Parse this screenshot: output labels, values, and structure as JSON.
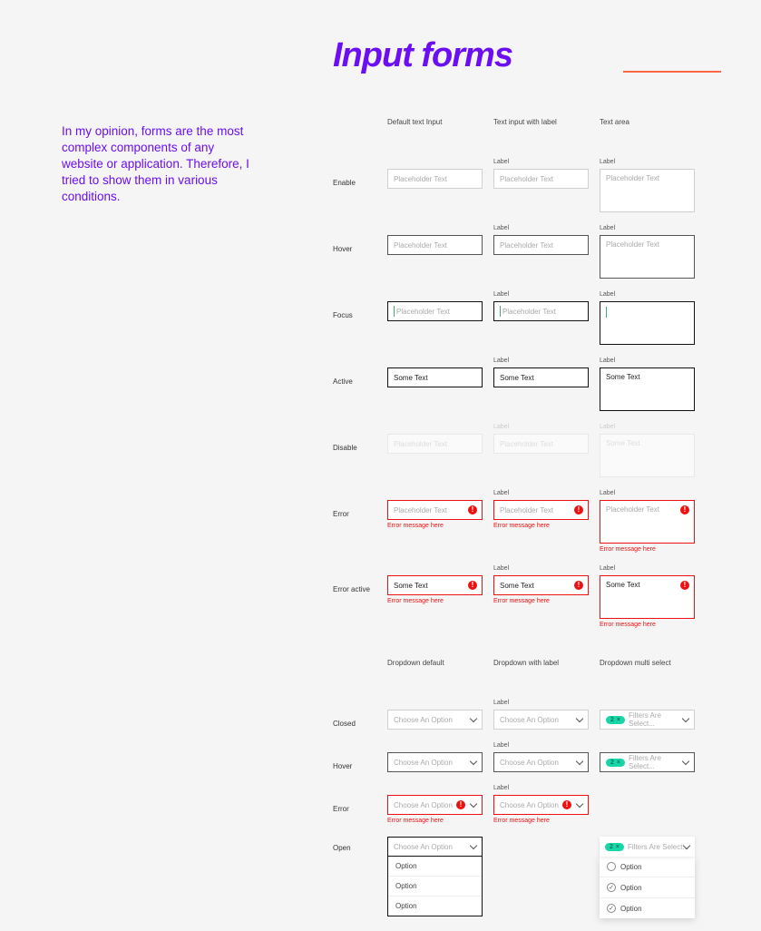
{
  "title": "Input forms",
  "intro": "In my opinion, forms are the most complex components of any website or application. Therefore, I tried to show them in various conditions.",
  "label_word": "Label",
  "placeholder": "Placeholder Text",
  "some_text": "Some Text",
  "error_msg": "Error message here",
  "col_headers": {
    "c1": "Default text Input",
    "c2": "Text input with label",
    "c3": "Text area"
  },
  "dd_headers": {
    "c1": "Dropdown default",
    "c2": "Dropdown with label",
    "c3": "Dropdown multi select"
  },
  "rows": {
    "enable": "Enable",
    "hover": "Hover",
    "focus": "Focus",
    "active": "Active",
    "disable": "Disable",
    "error": "Error",
    "error_active": "Error active",
    "closed": "Closed",
    "open": "Open"
  },
  "dropdown": {
    "choose": "Choose An Option",
    "option": "Option",
    "filters": "Filters Are Select...",
    "pill_count": "2"
  }
}
